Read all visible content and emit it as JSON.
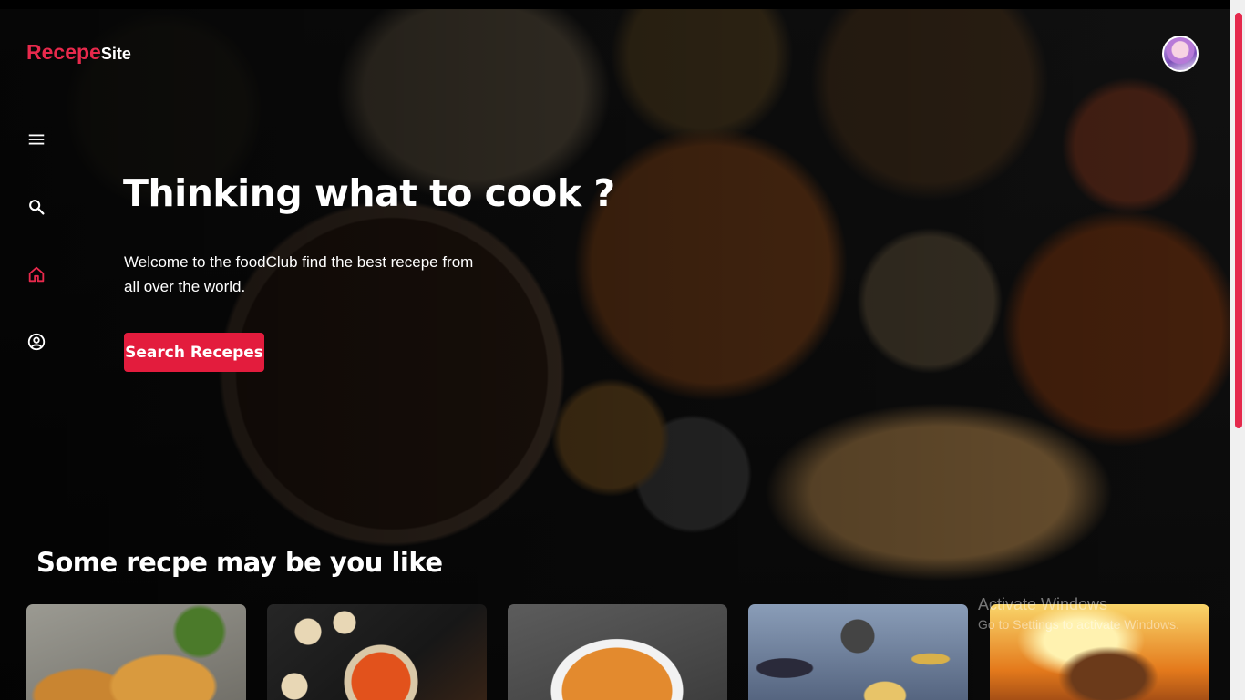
{
  "brand": {
    "name_main": "Recepe",
    "name_sub": "Site",
    "accent": "#e31c3d"
  },
  "sidebar": {
    "items": [
      {
        "icon": "menu-icon",
        "active": false
      },
      {
        "icon": "search-icon",
        "active": false
      },
      {
        "icon": "home-icon",
        "active": true
      },
      {
        "icon": "account-icon",
        "active": false
      }
    ]
  },
  "hero": {
    "title": "Thinking what to cook ?",
    "description": "Welcome to the foodClub find the best recepe from all over the world.",
    "button_label": "Search Recepes"
  },
  "recipes": {
    "section_title": "Some recpe may be you like",
    "cards": [
      {
        "image": "samosa-photo"
      },
      {
        "image": "momos-photo"
      },
      {
        "image": "noodles-photo"
      },
      {
        "image": "anime-poster"
      },
      {
        "image": "titan-poster"
      }
    ]
  },
  "watermark": {
    "title": "Activate Windows",
    "subtitle": "Go to Settings to activate Windows."
  }
}
